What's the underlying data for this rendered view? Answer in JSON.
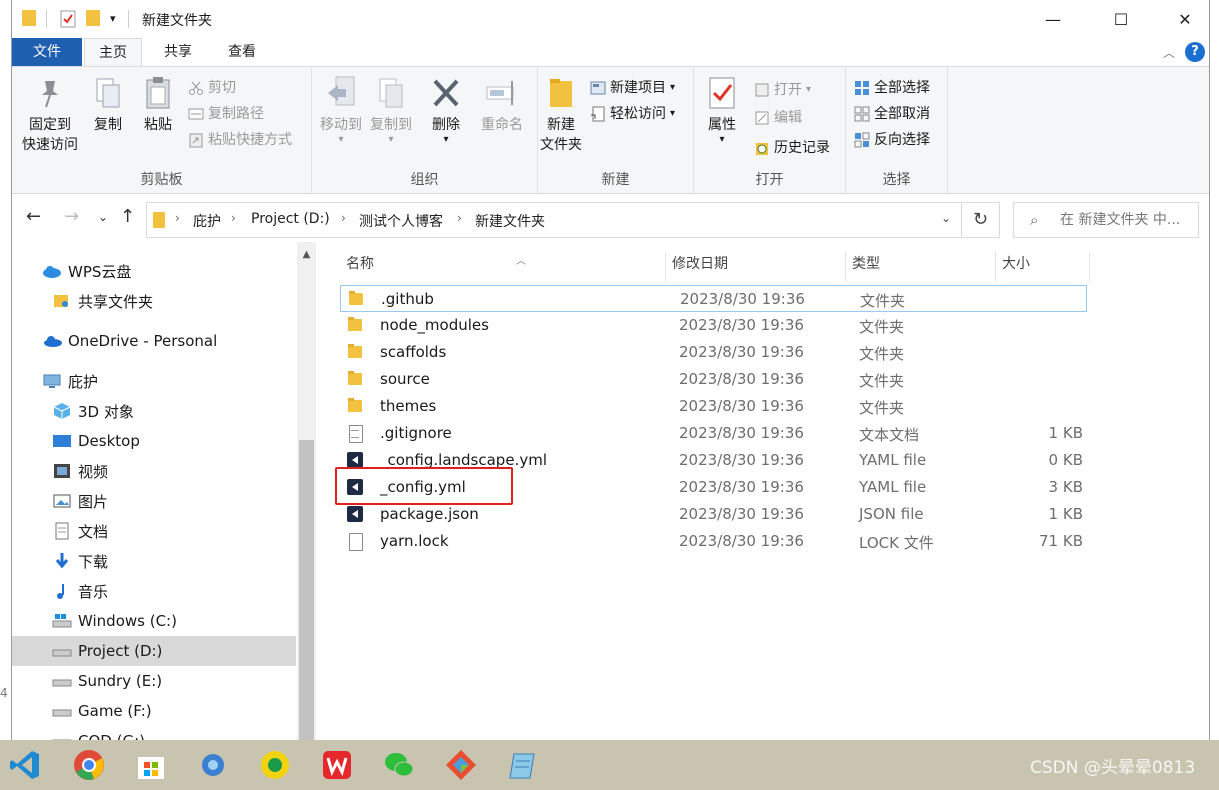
{
  "window": {
    "title": "新建文件夹",
    "controls": {
      "minimize": "—",
      "maximize": "☐",
      "close": "✕"
    }
  },
  "ribbon_tabs": [
    "文件",
    "主页",
    "共享",
    "查看"
  ],
  "ribbon": {
    "clipboard": {
      "label": "剪贴板",
      "pin": "固定到",
      "pin2": "快速访问",
      "copy": "复制",
      "paste": "粘贴",
      "cut": "剪切",
      "copy_path": "复制路径",
      "paste_shortcut": "粘贴快捷方式"
    },
    "organize": {
      "label": "组织",
      "move_to": "移动到",
      "copy_to": "复制到",
      "delete": "删除",
      "rename": "重命名"
    },
    "new": {
      "label": "新建",
      "new_folder": "新建",
      "new_folder2": "文件夹",
      "new_item": "新建项目",
      "easy_access": "轻松访问"
    },
    "open": {
      "label": "打开",
      "properties": "属性",
      "open": "打开",
      "edit": "编辑",
      "history": "历史记录"
    },
    "select": {
      "label": "选择",
      "select_all": "全部选择",
      "select_none": "全部取消",
      "invert": "反向选择"
    }
  },
  "address": {
    "crumbs": [
      "庇护",
      "Project (D:)",
      "测试个人博客",
      "新建文件夹"
    ],
    "search_placeholder": "在 新建文件夹 中..."
  },
  "nav": [
    {
      "label": "WPS云盘",
      "icon": "cloud-icon"
    },
    {
      "label": "共享文件夹",
      "icon": "shared-folder-icon"
    },
    {
      "label": "OneDrive - Personal",
      "icon": "onedrive-icon"
    },
    {
      "label": "庇护",
      "icon": "this-pc-icon"
    },
    {
      "label": "3D 对象",
      "icon": "3d-objects-icon"
    },
    {
      "label": "Desktop",
      "icon": "desktop-icon"
    },
    {
      "label": "视频",
      "icon": "video-icon"
    },
    {
      "label": "图片",
      "icon": "picture-icon"
    },
    {
      "label": "文档",
      "icon": "document-icon"
    },
    {
      "label": "下载",
      "icon": "download-icon"
    },
    {
      "label": "音乐",
      "icon": "music-icon"
    },
    {
      "label": "Windows (C:)",
      "icon": "drive-icon"
    },
    {
      "label": "Project (D:)",
      "icon": "drive-icon",
      "selected": true
    },
    {
      "label": "Sundry (E:)",
      "icon": "drive-icon"
    },
    {
      "label": "Game (F:)",
      "icon": "drive-icon"
    },
    {
      "label": "COD (G:)",
      "icon": "drive-icon"
    }
  ],
  "columns": [
    "名称",
    "修改日期",
    "类型",
    "大小"
  ],
  "files": [
    {
      "name": ".github",
      "date": "2023/8/30 19:36",
      "type": "文件夹",
      "size": "",
      "icon": "folder-icon"
    },
    {
      "name": "node_modules",
      "date": "2023/8/30 19:36",
      "type": "文件夹",
      "size": "",
      "icon": "folder-icon"
    },
    {
      "name": "scaffolds",
      "date": "2023/8/30 19:36",
      "type": "文件夹",
      "size": "",
      "icon": "folder-icon"
    },
    {
      "name": "source",
      "date": "2023/8/30 19:36",
      "type": "文件夹",
      "size": "",
      "icon": "folder-icon"
    },
    {
      "name": "themes",
      "date": "2023/8/30 19:36",
      "type": "文件夹",
      "size": "",
      "icon": "folder-icon"
    },
    {
      "name": ".gitignore",
      "date": "2023/8/30 19:36",
      "type": "文本文档",
      "size": "1 KB",
      "icon": "text-file-icon"
    },
    {
      "name": "_config.landscape.yml",
      "date": "2023/8/30 19:36",
      "type": "YAML file",
      "size": "0 KB",
      "icon": "vscode-file-icon"
    },
    {
      "name": "_config.yml",
      "date": "2023/8/30 19:36",
      "type": "YAML file",
      "size": "3 KB",
      "icon": "vscode-file-icon"
    },
    {
      "name": "package.json",
      "date": "2023/8/30 19:36",
      "type": "JSON file",
      "size": "1 KB",
      "icon": "vscode-file-icon"
    },
    {
      "name": "yarn.lock",
      "date": "2023/8/30 19:36",
      "type": "LOCK 文件",
      "size": "71 KB",
      "icon": "blank-file-icon"
    }
  ],
  "taskbar": {
    "apps": [
      "vscode-icon",
      "chrome-icon",
      "store-icon",
      "settings-app-icon",
      "media-app-icon",
      "wps-icon",
      "wechat-icon",
      "git-icon",
      "notepad-icon"
    ],
    "watermark": "CSDN @头晕晕0813"
  },
  "edge_fragment": "4"
}
